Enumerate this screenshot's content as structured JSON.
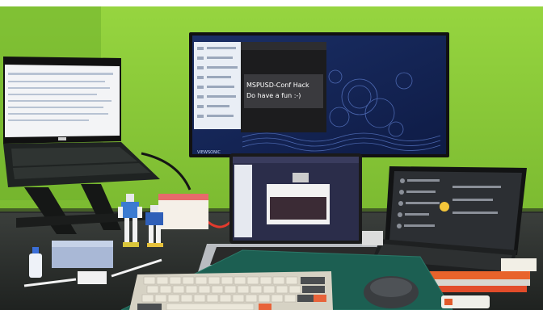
{
  "photo": {
    "wall_color": "#8ccd3a",
    "desk_color": "#2b2e2c",
    "monitor_slide_lines": [
      "MSPUSD-Conf Hack",
      "Do have a fun :-)"
    ],
    "monitor_brand": "VIEWSONIC"
  }
}
